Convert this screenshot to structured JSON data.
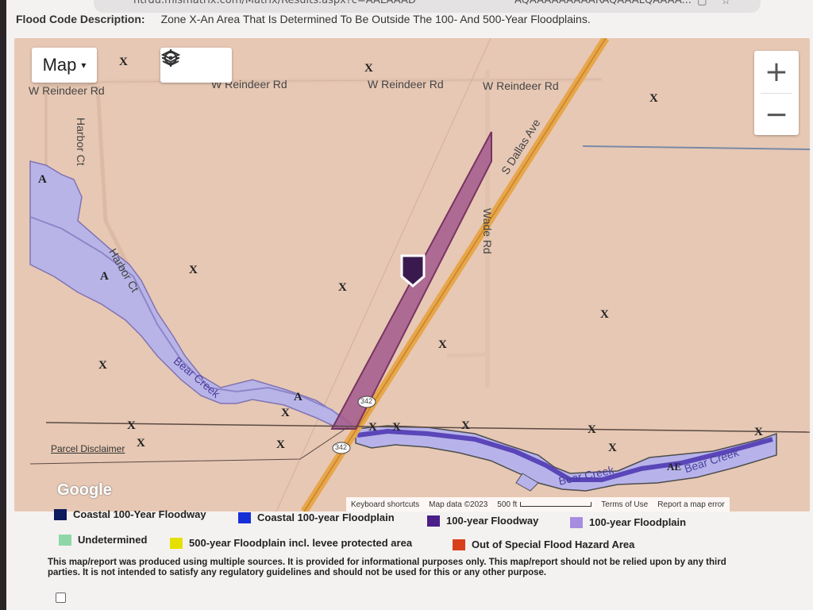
{
  "browser": {
    "url_left": "ntrdu.mlsmatrix.com/Matrix/Results.aspx?c=AALAAAD",
    "url_right": "AQAAAAAAAAARAQAAALQAAAA..."
  },
  "header": {
    "label": "Flood Code Description:",
    "value": "Zone X-An Area That Is Determined To Be Outside The 100- And 500-Year Floodplains."
  },
  "map": {
    "type_button": "Map",
    "zoom_in": "+",
    "zoom_out": "−",
    "roads": [
      "W Reindeer Rd",
      "W Reindeer Rd",
      "W Reindeer Rd",
      "W Reindeer Rd",
      "Harbor Ct",
      "Harbor Ct",
      "S Dallas Ave",
      "Wade Rd"
    ],
    "creeks": [
      "Bear Creek",
      "Bear Creek",
      "Bear Creek"
    ],
    "route_shield": "342",
    "zone_labels": {
      "x": "X",
      "a": "A",
      "ae": "AE"
    },
    "parcel_disclaimer": "Parcel Disclaimer",
    "google": "Google",
    "attribution": {
      "shortcuts": "Keyboard shortcuts",
      "map_data": "Map data ©2023",
      "scale": "500 ft",
      "terms": "Terms of Use",
      "report": "Report a map error"
    }
  },
  "legend": [
    {
      "label": "Coastal 100-Year Floodway",
      "color": "#0c1a5e"
    },
    {
      "label": "Coastal 100-year Floodplain",
      "color": "#1630d8"
    },
    {
      "label": "100-year Floodway",
      "color": "#4a1f8a"
    },
    {
      "label": "100-year Floodplain",
      "color": "#a58ee0"
    },
    {
      "label": "Undetermined",
      "color": "#8fd7a8"
    },
    {
      "label": "500-year Floodplain incl. levee protected area",
      "color": "#e6e000"
    },
    {
      "label": "Out of Special Flood Hazard Area",
      "color": "#d8401c"
    }
  ],
  "disclaimer": "This map/report was produced using multiple sources. It is provided for informational purposes only. This map/report should not be relied upon by any third parties. It is not intended to satisfy any regulatory guidelines and should not be used for this or any other purpose."
}
